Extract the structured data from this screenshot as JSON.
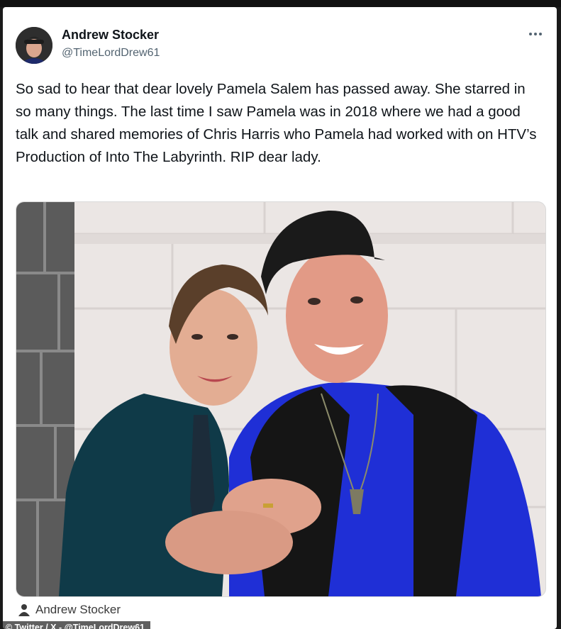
{
  "post": {
    "author": {
      "display_name": "Andrew Stocker",
      "handle": "@TimeLordDrew61",
      "avatar_icon": "avatar-photo"
    },
    "more_icon": "more-options-icon",
    "text": "So sad to hear that dear lovely Pamela Salem has passed away. She starred in so many things. The last time I saw Pamela was in 2018 where we had a good talk and shared memories of Chris Harris who Pamela had worked with on HTV’s Production of Into The Labyrinth. RIP dear lady.",
    "media": {
      "type": "photo",
      "description_icon": "photo-of-two-people"
    }
  },
  "credit": {
    "name": "Andrew Stocker",
    "icon": "person-icon",
    "watermark": "© Twitter / X - @TimeLordDrew61"
  },
  "colors": {
    "text_primary": "#0f1419",
    "text_secondary": "#536471",
    "card_bg": "#ffffff",
    "page_bg": "#1a1a1a"
  }
}
